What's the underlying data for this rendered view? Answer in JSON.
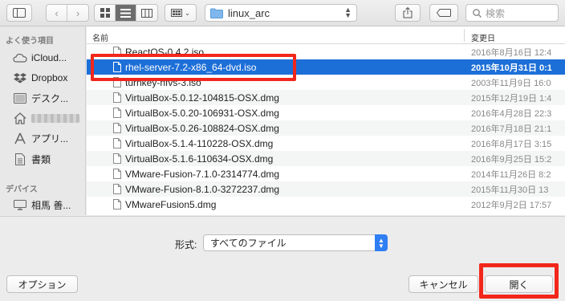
{
  "toolbar": {
    "path_label": "linux_arc",
    "search_placeholder": "検索"
  },
  "sidebar": {
    "favorites_heading": "よく使う項目",
    "devices_heading": "デバイス",
    "items": [
      {
        "label": "iCloud..."
      },
      {
        "label": "Dropbox"
      },
      {
        "label": "デスク..."
      },
      {
        "label": ""
      },
      {
        "label": "アプリ..."
      },
      {
        "label": "書類"
      },
      {
        "label": "相馬 善..."
      }
    ]
  },
  "list": {
    "col_name": "名前",
    "col_date": "変更日",
    "rows": [
      {
        "name": "ReactOS-0.4.2.iso",
        "date": "2016年8月16日 12:4"
      },
      {
        "name": "rhel-server-7.2-x86_64-dvd.iso",
        "date": "2015年10月31日 0:1",
        "selected": true
      },
      {
        "name": "turnkey-nfvs-3.iso",
        "date": "2003年11月9日 16:0"
      },
      {
        "name": "VirtualBox-5.0.12-104815-OSX.dmg",
        "date": "2015年12月19日 1:4"
      },
      {
        "name": "VirtualBox-5.0.20-106931-OSX.dmg",
        "date": "2016年4月28日 22:3"
      },
      {
        "name": "VirtualBox-5.0.26-108824-OSX.dmg",
        "date": "2016年7月18日 21:1"
      },
      {
        "name": "VirtualBox-5.1.4-110228-OSX.dmg",
        "date": "2016年8月17日 3:15"
      },
      {
        "name": "VirtualBox-5.1.6-110634-OSX.dmg",
        "date": "2016年9月25日 15:2"
      },
      {
        "name": "VMware-Fusion-7.1.0-2314774.dmg",
        "date": "2014年11月26日 8:2"
      },
      {
        "name": "VMware-Fusion-8.1.0-3272237.dmg",
        "date": "2015年11月30日 13"
      },
      {
        "name": "VMwareFusion5.dmg",
        "date": "2012年9月2日 17:57"
      }
    ]
  },
  "format": {
    "label": "形式:",
    "selected": "すべてのファイル"
  },
  "buttons": {
    "options": "オプション",
    "cancel": "キャンセル",
    "open": "開く"
  },
  "colors": {
    "selection": "#1d6fd8",
    "annotation": "#f2271b"
  }
}
